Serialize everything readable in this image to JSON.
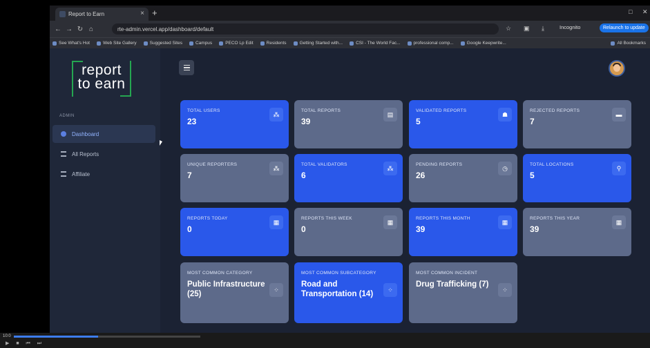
{
  "browser": {
    "tab_title": "Report to Earn",
    "url": "rte-admin.vercel.app/dashboard/default",
    "incognito_label": "Incognito",
    "relaunch_label": "Relaunch to update",
    "bookmarks": [
      "See What's Hot",
      "Web Site Gallery",
      "Suggested Sites",
      "Campus",
      "PECO Lp Edit",
      "Residents",
      "Getting Started with...",
      "CSI - The World Fac...",
      "professional comp...",
      "Google Keepwrite..."
    ],
    "all_bookmarks_label": "All Bookmarks"
  },
  "sidebar": {
    "logo_line1": "report",
    "logo_line2": "to earn",
    "section_label": "ADMIN",
    "items": [
      {
        "label": "Dashboard",
        "active": true
      },
      {
        "label": "All Reports",
        "active": false
      },
      {
        "label": "Affiliate",
        "active": false
      }
    ]
  },
  "cards": [
    {
      "label": "TOTAL USERS",
      "value": "23",
      "color": "blue",
      "icon": "users-icon"
    },
    {
      "label": "TOTAL REPORTS",
      "value": "39",
      "color": "gray",
      "icon": "document-icon"
    },
    {
      "label": "VALIDATED REPORTS",
      "value": "5",
      "color": "blue",
      "icon": "ghost-icon"
    },
    {
      "label": "REJECTED REPORTS",
      "value": "7",
      "color": "gray",
      "icon": "chat-icon"
    },
    {
      "label": "UNIQUE REPORTERS",
      "value": "7",
      "color": "gray",
      "icon": "users-icon"
    },
    {
      "label": "TOTAL VALIDATORS",
      "value": "6",
      "color": "blue",
      "icon": "users-icon"
    },
    {
      "label": "PENDING REPORTS",
      "value": "26",
      "color": "gray",
      "icon": "clock-icon"
    },
    {
      "label": "TOTAL LOCATIONS",
      "value": "5",
      "color": "blue",
      "icon": "location-pin-icon"
    },
    {
      "label": "REPORTS TODAY",
      "value": "0",
      "color": "blue",
      "icon": "calendar-icon"
    },
    {
      "label": "REPORTS THIS WEEK",
      "value": "0",
      "color": "gray",
      "icon": "calendar-icon"
    },
    {
      "label": "REPORTS THIS MONTH",
      "value": "39",
      "color": "blue",
      "icon": "calendar-icon"
    },
    {
      "label": "REPORTS THIS YEAR",
      "value": "39",
      "color": "gray",
      "icon": "calendar-icon"
    },
    {
      "label": "MOST COMMON CATEGORY",
      "value": "Public Infrastructure (25)",
      "color": "gray",
      "icon": "grid-icon"
    },
    {
      "label": "MOST COMMON SUBCATEGORY",
      "value": "Road and Transportation (14)",
      "color": "blue",
      "icon": "grid-icon"
    },
    {
      "label": "MOST COMMON INCIDENT",
      "value": "Drug Trafficking (7)",
      "color": "gray",
      "icon": "grid-icon"
    }
  ],
  "colors": {
    "accent_blue": "#2a58ea",
    "card_gray": "#5d6a8a",
    "logo_green": "#25a651",
    "sidebar_bg": "#1f2739"
  }
}
